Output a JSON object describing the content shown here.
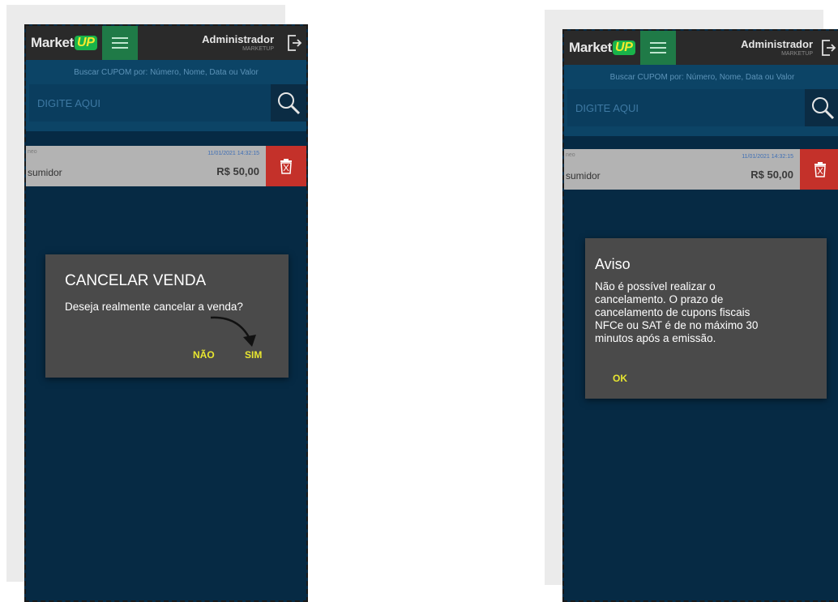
{
  "left_screen": {
    "header": {
      "logo_text": "Market",
      "logo_badge": "UP",
      "admin_name": "Administrador",
      "admin_sub": "MARKETUP"
    },
    "search": {
      "hint": "Buscar CUPOM por: Número, Nome, Data ou Valor",
      "placeholder": "DIGITE AQUI"
    },
    "sale": {
      "label_small": "neo",
      "date": "11/01/2021 14:32:15",
      "client": "sumidor",
      "value": "R$ 50,00"
    },
    "dialog": {
      "title": "CANCELAR VENDA",
      "message": "Deseja realmente cancelar a venda?",
      "no_label": "NÃO",
      "yes_label": "SIM"
    }
  },
  "right_screen": {
    "header": {
      "logo_text": "Market",
      "logo_badge": "UP",
      "admin_name": "Administrador",
      "admin_sub": "MARKETUP"
    },
    "search": {
      "hint": "Buscar CUPOM por: Número, Nome, Data ou Valor",
      "placeholder": "DIGITE AQUI"
    },
    "sale": {
      "label_small": "neo",
      "date": "11/01/2021 14:32:15",
      "client": "sumidor",
      "value": "R$ 50,00"
    },
    "dialog": {
      "title": "Aviso",
      "message": "Não é possível realizar o cancelamento. O prazo de cancelamento de cupons fiscais NFCe ou SAT é de no máximo 30 minutos após a emissão.",
      "ok_label": "OK"
    }
  },
  "colors": {
    "screen_bg": "#062a44",
    "accent_yellow": "#e8e630",
    "trash_red": "#c4312a",
    "menu_green": "#1f7a47"
  }
}
